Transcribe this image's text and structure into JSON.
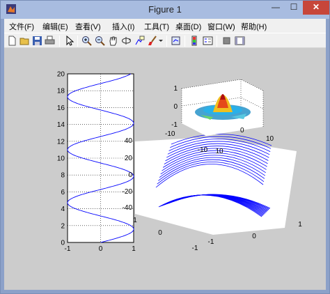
{
  "window": {
    "title": "Figure 1",
    "minimize_glyph": "—",
    "maximize_glyph": "☐",
    "close_glyph": "✕",
    "icon": "matlab-icon"
  },
  "menubar": {
    "items": [
      "文件(F)",
      "编辑(E)",
      "查看(V)",
      "插入(I)",
      "工具(T)",
      "桌面(D)",
      "窗口(W)",
      "帮助(H)"
    ]
  },
  "toolbar": {
    "icons": [
      "new-figure-icon",
      "open-file-icon",
      "save-icon",
      "print-icon",
      "select-arrow-icon",
      "zoom-in-icon",
      "zoom-out-icon",
      "pan-icon",
      "rotate-3d-icon",
      "data-cursor-icon",
      "brush-icon",
      "link-plot-icon",
      "insert-colorbar-icon",
      "insert-legend-icon",
      "hide-plot-tools-icon",
      "show-plot-tools-icon"
    ]
  },
  "colors": {
    "title_bar": "#A8BCE0",
    "close_button": "#C7463A",
    "figure_background": "#CCCCCC",
    "line": "#0000FF"
  },
  "chart_data": [
    {
      "type": "line",
      "description_key": "sin-curve-2d",
      "x_function": "sin(t)",
      "y_function": "t",
      "t_range": [
        0,
        20
      ],
      "xlim": [
        -1,
        1
      ],
      "ylim": [
        0,
        20
      ],
      "xticks": [
        "-1",
        "0",
        "1"
      ],
      "yticks": [
        "0",
        "2",
        "4",
        "6",
        "8",
        "10",
        "12",
        "14",
        "16",
        "18",
        "20"
      ],
      "grid": "dotted",
      "color": "#0000FF"
    },
    {
      "type": "heatmap",
      "description_key": "peaks-surface-3d",
      "zlim": [
        -1,
        1
      ],
      "xlim": [
        -10,
        10
      ],
      "ylim": [
        -10,
        10
      ],
      "zticks": [
        "-1",
        "0",
        "1"
      ],
      "xticks": [
        "-10",
        "10"
      ],
      "yticks": [
        "-10",
        "0",
        "10"
      ],
      "colormap": "jet"
    },
    {
      "type": "line",
      "description_key": "mesh-curves-3d",
      "zlim": [
        -40,
        40
      ],
      "zticks": [
        "-40",
        "-20",
        "0",
        "20",
        "40"
      ],
      "xticks": [
        "-1",
        "0",
        "1"
      ],
      "yticks": [
        "-1",
        "0",
        "1"
      ],
      "color": "#0000FF"
    }
  ]
}
